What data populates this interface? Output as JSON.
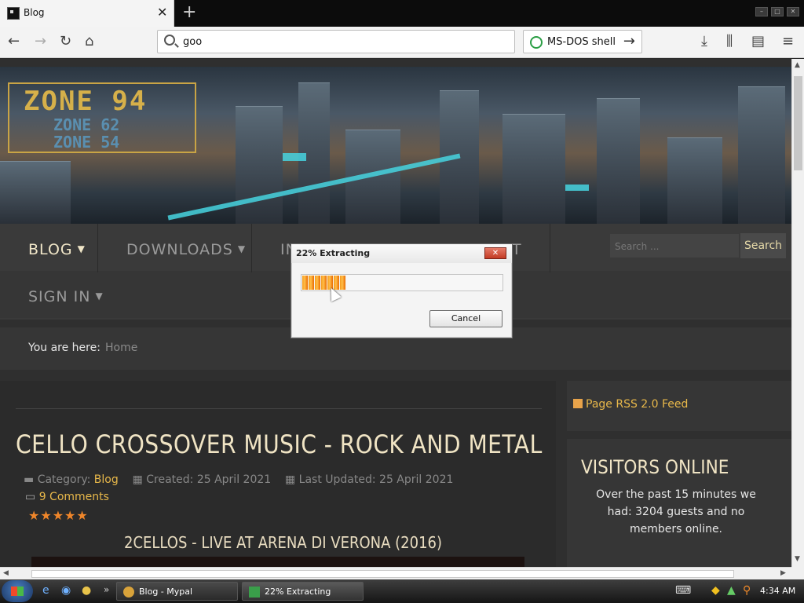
{
  "browser": {
    "tab_title": "Blog",
    "url_text": "goo",
    "search_engine_text": "MS-DOS shell"
  },
  "page": {
    "logo": {
      "line1": "ZONE 94",
      "line2": "ZONE 62",
      "line3": "ZONE 54"
    },
    "menu": {
      "items": [
        {
          "label": "BLOG",
          "active": true
        },
        {
          "label": "DOWNLOADS",
          "active": false
        },
        {
          "label": "IN",
          "active": false
        },
        {
          "label": "T",
          "active": false
        },
        {
          "label": "SIGN IN",
          "active": false
        }
      ],
      "search_placeholder": "Search ...",
      "search_button": "Search"
    },
    "breadcrumb": {
      "label": "You are here:",
      "home": "Home"
    },
    "article": {
      "title": "CELLO CROSSOVER MUSIC - ROCK AND METAL",
      "category_label": "Category:",
      "category": "Blog",
      "created": "Created: 25 April 2021",
      "updated": "Last Updated: 25 April 2021",
      "comments": "9 Comments",
      "stars": "★★★★★",
      "rating": 5,
      "video_title": "2CELLOS - LIVE AT ARENA DI VERONA (2016)"
    },
    "sidebar": {
      "rss": "Page RSS 2.0 Feed",
      "visitors_title": "VISITORS ONLINE",
      "visitors_text": "Over the past 15 minutes we had: 3204 guests and no members online."
    }
  },
  "dialog": {
    "title": "22% Extracting",
    "progress": 0.22,
    "cancel": "Cancel",
    "close": "✕"
  },
  "taskbar": {
    "tasks": [
      "Blog - Mypal",
      "22% Extracting"
    ],
    "clock": "4:34 AM"
  }
}
